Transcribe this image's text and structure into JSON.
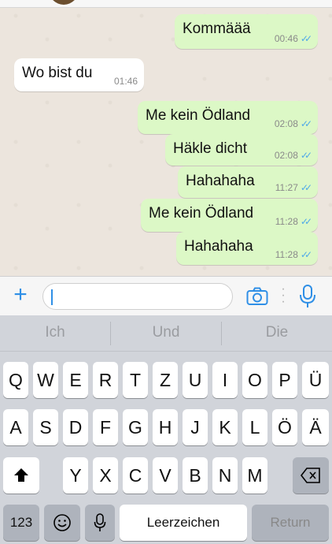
{
  "chat": {
    "messages": [
      {
        "direction": "out",
        "text": "Kommäää",
        "time": "00:46",
        "status": "read"
      },
      {
        "direction": "in",
        "text": "Wo bist du",
        "time": "01:46"
      },
      {
        "direction": "out",
        "text": "Me kein Ödland",
        "time": "02:08",
        "status": "read"
      },
      {
        "direction": "out",
        "text": "Häkle dicht",
        "time": "02:08",
        "status": "read"
      },
      {
        "direction": "out",
        "text": "Hahahaha",
        "time": "11:27",
        "status": "read"
      },
      {
        "direction": "out",
        "text": "Me kein Ödland",
        "time": "11:28",
        "status": "read"
      },
      {
        "direction": "out",
        "text": "Hahahaha",
        "time": "11:28",
        "status": "read"
      }
    ]
  },
  "input_bar": {
    "plus_icon": "plus-icon",
    "camera_icon": "camera-icon",
    "mic_icon": "microphone-icon",
    "message_value": "",
    "accent_color": "#2f8fe6"
  },
  "keyboard": {
    "suggestions": [
      "Ich",
      "Und",
      "Die"
    ],
    "row1": [
      "Q",
      "W",
      "E",
      "R",
      "T",
      "Z",
      "U",
      "I",
      "O",
      "P",
      "Ü"
    ],
    "row2": [
      "A",
      "S",
      "D",
      "F",
      "G",
      "H",
      "J",
      "K",
      "L",
      "Ö",
      "Ä"
    ],
    "row3": [
      "Y",
      "X",
      "C",
      "V",
      "B",
      "N",
      "M"
    ],
    "numbers_label": "123",
    "space_label": "Leerzeichen",
    "return_label": "Return",
    "shift_icon": "shift-icon",
    "delete_icon": "backspace-icon",
    "emoji_icon": "emoji-icon",
    "dictation_icon": "microphone-icon"
  }
}
